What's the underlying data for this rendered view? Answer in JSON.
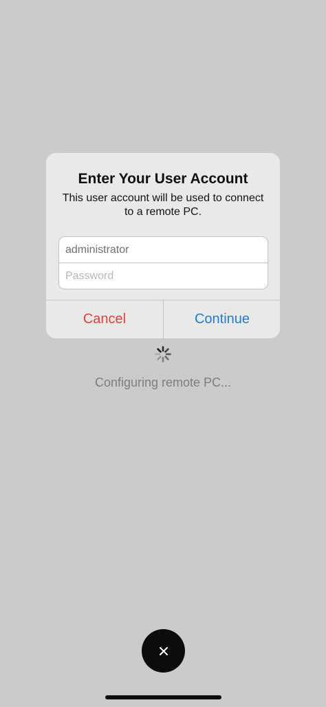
{
  "dialog": {
    "title": "Enter Your User Account",
    "message": "This user account will be used to connect to a remote PC.",
    "username_value": "administrator",
    "password_placeholder": "Password",
    "cancel_label": "Cancel",
    "continue_label": "Continue"
  },
  "status": {
    "text": "Configuring remote PC..."
  },
  "icons": {
    "spinner": "loading-spinner-icon",
    "close": "close-icon"
  },
  "colors": {
    "background": "#cbcbcb",
    "cancel": "#e0403a",
    "continue": "#1f7bd8"
  }
}
